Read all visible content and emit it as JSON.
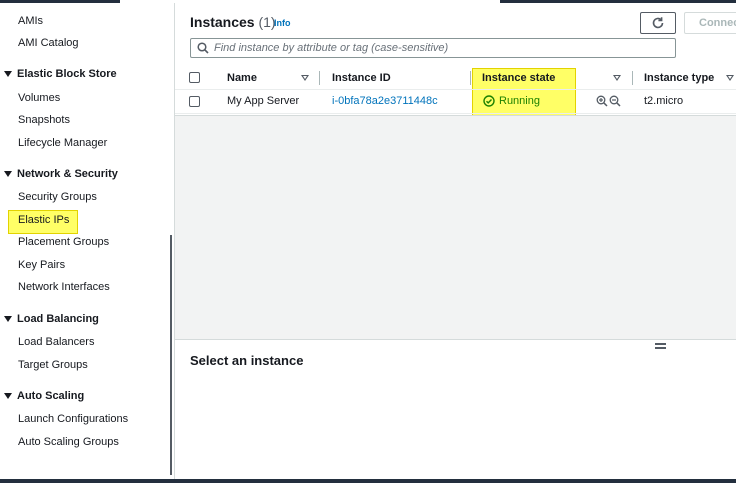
{
  "sidebar": {
    "items_top": [
      "AMIs",
      "AMI Catalog"
    ],
    "sections": [
      {
        "title": "Elastic Block Store",
        "items": [
          "Volumes",
          "Snapshots",
          "Lifecycle Manager"
        ]
      },
      {
        "title": "Network & Security",
        "items": [
          "Security Groups",
          "Elastic IPs",
          "Placement Groups",
          "Key Pairs",
          "Network Interfaces"
        ]
      },
      {
        "title": "Load Balancing",
        "items": [
          "Load Balancers",
          "Target Groups"
        ]
      },
      {
        "title": "Auto Scaling",
        "items": [
          "Launch Configurations",
          "Auto Scaling Groups"
        ]
      }
    ]
  },
  "header": {
    "title": "Instances",
    "count": "(1)",
    "info": "Info",
    "connect_label": "Connect"
  },
  "search": {
    "placeholder": "Find instance by attribute or tag (case-sensitive)"
  },
  "table": {
    "columns": [
      "Name",
      "Instance ID",
      "Instance state",
      "Instance type"
    ],
    "rows": [
      {
        "name": "My App Server",
        "instance_id": "i-0bfa78a2e3711448c",
        "state": "Running",
        "type": "t2.micro"
      }
    ]
  },
  "details": {
    "title": "Select an instance"
  },
  "colors": {
    "link": "#0073bb",
    "running": "#1d8102",
    "highlight": "#ffff66",
    "nav_dark": "#232f3e"
  },
  "icons": [
    "refresh-icon",
    "search-icon",
    "check-circle-icon",
    "zoom-in-icon",
    "zoom-out-icon",
    "caret-down-icon",
    "sort-icon",
    "drag-handle-icon"
  ]
}
